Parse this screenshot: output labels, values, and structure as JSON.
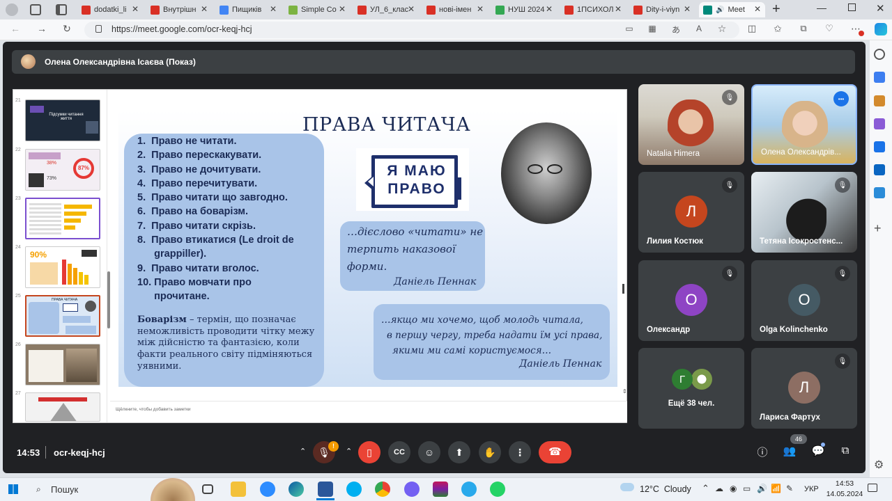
{
  "browser": {
    "tabs": [
      {
        "label": "dodatki_li",
        "color": "#d93025"
      },
      {
        "label": "Внутрішн",
        "color": "#d93025"
      },
      {
        "label": "Пищиків",
        "color": "#4285f4"
      },
      {
        "label": "Simple Co",
        "color": "#7cb342"
      },
      {
        "label": "УЛ_6_клас",
        "color": "#d93025"
      },
      {
        "label": "нові-імен",
        "color": "#d93025"
      },
      {
        "label": "НУШ 2024",
        "color": "#34a853"
      },
      {
        "label": "1ПСИХОЛ",
        "color": "#d93025"
      },
      {
        "label": "Dity-i-viyn",
        "color": "#d93025"
      },
      {
        "label": "Meet",
        "color": "#00897b"
      }
    ],
    "url": "https://meet.google.com/ocr-keqj-hcj"
  },
  "presenter": {
    "label": "Олена Олександрівна Ісаєва (Показ)"
  },
  "slide": {
    "title": "ПРАВА ЧИТАЧА",
    "rights": [
      "1.  Право не читати.",
      "2.  Право перескакувати.",
      "3.  Право не дочитувати.",
      "4.  Право перечитувати.",
      "5.  Право читати що завгодно.",
      "6.  Право на боварізм.",
      "7.  Право читати скрізь.",
      "8.  Право втикатися (Le droit de",
      "      grappiller).",
      "9.  Право читати вголос.",
      "10. Право мовчати про",
      "      прочитане."
    ],
    "definition_term": "Боварізм",
    "definition_text": " – термін, що позначає неможливість проводити чітку межу між дійсністю та фантазією, коли факти реального світу підміняються уявними.",
    "logo_line1": "Я МАЮ",
    "logo_line2": "ПРАВО",
    "quote1": "…дієслово «читати» не терпить наказової форми.",
    "quote1_author": "Даніель Пеннак",
    "quote2_lines": [
      "…якщо ми хочемо, щоб молодь читала,",
      "в першу чергу, треба надати їм усі права,",
      "якими ми  самі користуємося…"
    ],
    "quote2_author": "Даніель Пеннак",
    "notes_placeholder": "Щёлкните, чтобы добавить заметки"
  },
  "thumbnails": {
    "numbers": [
      "21",
      "22",
      "23",
      "24",
      "25",
      "26",
      "27"
    ],
    "t21_text": "Підсумки читання життя",
    "t22_pct": [
      "38%",
      "87%",
      "73%"
    ],
    "t24_pct": "90%",
    "t25_title": "ПРАВА ЧИТАЧА"
  },
  "participants": [
    {
      "name": "Natalia Himera",
      "muted": true,
      "video": true
    },
    {
      "name": "Олена Олександрів...",
      "muted": false,
      "video": true
    },
    {
      "name": "Лилия Костюк",
      "initial": "Л",
      "color": "#c5461e",
      "muted": true
    },
    {
      "name": "Тетяна Ісокростенс...",
      "muted": true,
      "video": true
    },
    {
      "name": "Олександр",
      "initial": "О",
      "color": "#8e44c4",
      "muted": true
    },
    {
      "name": "Olga Kolinchenko",
      "initial": "O",
      "color": "#455a64",
      "muted": true
    },
    {
      "name": "Ещё 38 чел.",
      "initial": "Г",
      "color": "#2e7d32"
    },
    {
      "name": "Лариса Фартух",
      "initial": "Л",
      "color": "#8d6e63",
      "muted": true
    }
  ],
  "bottom": {
    "time": "14:53",
    "code": "ocr-keqj-hcj",
    "people_count": "46",
    "mic_badge": "!"
  },
  "taskbar": {
    "search": "Пошук",
    "weather": "12°C  Cloudy",
    "lang": "УКР",
    "time": "14:53",
    "date": "14.05.2024"
  }
}
